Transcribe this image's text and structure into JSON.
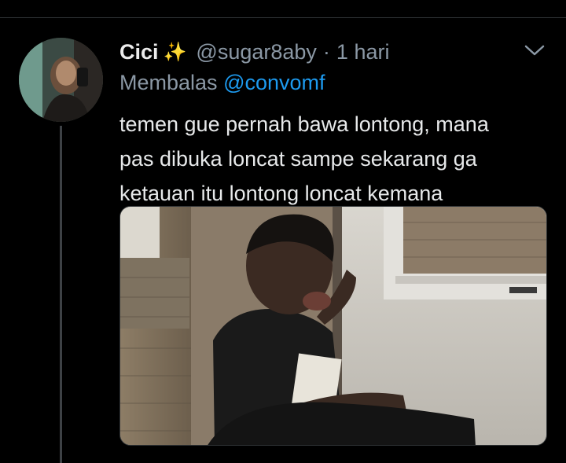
{
  "tweet": {
    "display_name": "Cici",
    "name_emoji": "✨",
    "handle": "@sugar8aby",
    "separator": "·",
    "time": "1 hari",
    "reply_prefix": "Membalas",
    "reply_to": "@convomf",
    "text_lines": [
      "temen gue pernah bawa lontong, mana",
      "pas dibuka loncat sampe sekarang ga",
      "ketauan itu lontong loncat kemana"
    ]
  },
  "icons": {
    "more": "chevron-down-icon",
    "name_badge": "sparkle-icon"
  },
  "colors": {
    "background": "#000000",
    "mention": "#1d9bf0",
    "secondary_text": "#8b98a5",
    "primary_text": "#e7e9ea"
  }
}
